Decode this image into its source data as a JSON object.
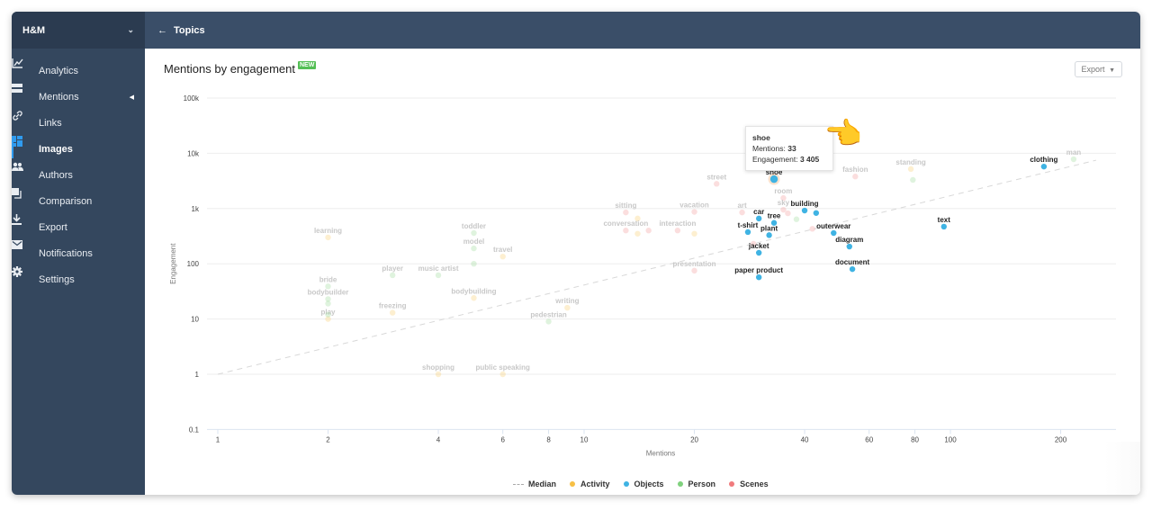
{
  "sidebar": {
    "brand": "H&M",
    "items": [
      {
        "label": "Analytics",
        "icon": "chart-icon",
        "active": false
      },
      {
        "label": "Mentions",
        "icon": "list-icon",
        "active": false,
        "has_submenu": true
      },
      {
        "label": "Links",
        "icon": "link-icon",
        "active": false
      },
      {
        "label": "Images",
        "icon": "grid-icon",
        "active": true
      },
      {
        "label": "Authors",
        "icon": "users-icon",
        "active": false
      },
      {
        "label": "Comparison",
        "icon": "compare-icon",
        "active": false
      },
      {
        "label": "Export",
        "icon": "download-icon",
        "active": false
      },
      {
        "label": "Notifications",
        "icon": "envelope-icon",
        "active": false
      },
      {
        "label": "Settings",
        "icon": "gear-icon",
        "active": false
      }
    ]
  },
  "topbar": {
    "back_label": "Topics"
  },
  "panel": {
    "title": "Mentions by engagement",
    "badge": "NEW",
    "export_label": "Export"
  },
  "tooltip": {
    "name": "shoe",
    "mentions_label": "Mentions:",
    "mentions_value": "33",
    "engagement_label": "Engagement:",
    "engagement_value": "3 405"
  },
  "colors": {
    "Activity": "#f7c045",
    "Objects": "#3fb3e3",
    "Person": "#7fd17d",
    "Scenes": "#f07a7c",
    "Median": "#cccccc"
  },
  "chart_data": {
    "type": "scatter",
    "title": "Mentions by engagement",
    "xlabel": "Mentions",
    "ylabel": "Engagement",
    "xscale": "log",
    "yscale": "log",
    "xlim": [
      0.97,
      300
    ],
    "ylim": [
      0.1,
      100000
    ],
    "xticks": [
      1,
      2,
      4,
      6,
      8,
      10,
      20,
      40,
      60,
      80,
      100,
      200
    ],
    "xtick_labels": [
      "1",
      "2",
      "4",
      "6",
      "8",
      "10",
      "20",
      "40",
      "60",
      "80",
      "100",
      "200"
    ],
    "yticks": [
      0.1,
      1,
      10,
      100,
      1000,
      10000,
      100000
    ],
    "ytick_labels": [
      "0.1",
      "1",
      "10",
      "100",
      "1k",
      "10k",
      "100k"
    ],
    "grid": true,
    "legend": [
      "Median",
      "Activity",
      "Objects",
      "Person",
      "Scenes"
    ],
    "legend_position": "bottom",
    "median_line": {
      "from": [
        1,
        1
      ],
      "to": [
        250,
        7500
      ]
    },
    "highlighted_series": "Objects",
    "points": [
      {
        "label": "shoe",
        "series": "Objects",
        "x": 33,
        "y": 3405,
        "hover": true
      },
      {
        "label": "clothing",
        "series": "Objects",
        "x": 180,
        "y": 5750
      },
      {
        "label": "text",
        "series": "Objects",
        "x": 96,
        "y": 470
      },
      {
        "label": "document",
        "series": "Objects",
        "x": 54,
        "y": 80
      },
      {
        "label": "diagram",
        "series": "Objects",
        "x": 53,
        "y": 205
      },
      {
        "label": "outerwear",
        "series": "Objects",
        "x": 48,
        "y": 360
      },
      {
        "label": "building",
        "series": "Objects",
        "x": 40,
        "y": 920
      },
      {
        "label": "",
        "series": "Objects",
        "x": 43,
        "y": 830
      },
      {
        "label": "car",
        "series": "Objects",
        "x": 30,
        "y": 660
      },
      {
        "label": "tree",
        "series": "Objects",
        "x": 33,
        "y": 550
      },
      {
        "label": "plant",
        "series": "Objects",
        "x": 32,
        "y": 330
      },
      {
        "label": "t-shirt",
        "series": "Objects",
        "x": 28,
        "y": 375
      },
      {
        "label": "jacket",
        "series": "Objects",
        "x": 30,
        "y": 158
      },
      {
        "label": "paper product",
        "series": "Objects",
        "x": 30,
        "y": 57
      },
      {
        "label": "man",
        "series": "Person",
        "x": 217,
        "y": 7800
      },
      {
        "label": "standing",
        "series": "Activity",
        "x": 78,
        "y": 5200
      },
      {
        "label": "",
        "series": "Person",
        "x": 79,
        "y": 3300
      },
      {
        "label": "fashion",
        "series": "Scenes",
        "x": 55,
        "y": 3800
      },
      {
        "label": "street",
        "series": "Scenes",
        "x": 23,
        "y": 2800
      },
      {
        "label": "room",
        "series": "Scenes",
        "x": 35,
        "y": 1550
      },
      {
        "label": "sky",
        "series": "Scenes",
        "x": 35,
        "y": 950
      },
      {
        "label": "",
        "series": "Scenes",
        "x": 36,
        "y": 820
      },
      {
        "label": "",
        "series": "Person",
        "x": 38,
        "y": 640
      },
      {
        "label": "art",
        "series": "Scenes",
        "x": 27,
        "y": 850
      },
      {
        "label": "vacation",
        "series": "Scenes",
        "x": 20,
        "y": 870
      },
      {
        "label": "sitting",
        "series": "Scenes",
        "x": 13,
        "y": 850
      },
      {
        "label": "",
        "series": "Activity",
        "x": 14,
        "y": 660
      },
      {
        "label": "conversation",
        "series": "Scenes",
        "x": 13,
        "y": 400
      },
      {
        "label": "",
        "series": "Activity",
        "x": 14,
        "y": 350
      },
      {
        "label": "",
        "series": "Scenes",
        "x": 15,
        "y": 400
      },
      {
        "label": "interaction",
        "series": "Scenes",
        "x": 18,
        "y": 400
      },
      {
        "label": "",
        "series": "Activity",
        "x": 20,
        "y": 350
      },
      {
        "label": "",
        "series": "Scenes",
        "x": 42,
        "y": 430
      },
      {
        "label": "",
        "series": "Scenes",
        "x": 29,
        "y": 230
      },
      {
        "label": "presentation",
        "series": "Scenes",
        "x": 20,
        "y": 75
      },
      {
        "label": "learning",
        "series": "Activity",
        "x": 2,
        "y": 300
      },
      {
        "label": "toddler",
        "series": "Person",
        "x": 5,
        "y": 360
      },
      {
        "label": "model",
        "series": "Person",
        "x": 5,
        "y": 190
      },
      {
        "label": "",
        "series": "Person",
        "x": 5,
        "y": 100
      },
      {
        "label": "travel",
        "series": "Activity",
        "x": 6,
        "y": 135
      },
      {
        "label": "player",
        "series": "Person",
        "x": 3,
        "y": 62
      },
      {
        "label": "music artist",
        "series": "Person",
        "x": 4,
        "y": 62
      },
      {
        "label": "bride",
        "series": "Person",
        "x": 2,
        "y": 39
      },
      {
        "label": "bodybuilder",
        "series": "Person",
        "x": 2,
        "y": 23
      },
      {
        "label": "",
        "series": "Person",
        "x": 2,
        "y": 19
      },
      {
        "label": "play",
        "series": "Activity",
        "x": 2,
        "y": 10
      },
      {
        "label": "",
        "series": "Person",
        "x": 2,
        "y": 12
      },
      {
        "label": "freezing",
        "series": "Activity",
        "x": 3,
        "y": 13
      },
      {
        "label": "bodybuilding",
        "series": "Activity",
        "x": 5,
        "y": 24
      },
      {
        "label": "writing",
        "series": "Activity",
        "x": 9,
        "y": 16
      },
      {
        "label": "pedestrian",
        "series": "Person",
        "x": 8,
        "y": 9
      },
      {
        "label": "shopping",
        "series": "Activity",
        "x": 4,
        "y": 1
      },
      {
        "label": "public speaking",
        "series": "Activity",
        "x": 6,
        "y": 1
      }
    ]
  }
}
